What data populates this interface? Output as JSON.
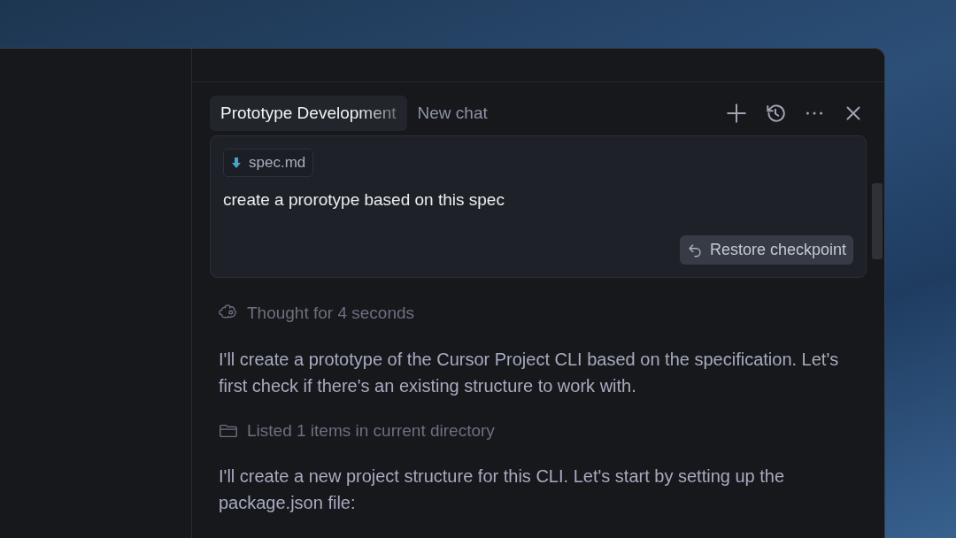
{
  "tabs": [
    {
      "label": "Prototype Development",
      "selected": true
    },
    {
      "label": "New chat",
      "selected": false
    }
  ],
  "message": {
    "attachment": "spec.md",
    "text": "create a prorotype based on this spec",
    "restore_button": "Restore checkpoint"
  },
  "response": [
    {
      "kind": "thought",
      "text": "Thought for 4 seconds"
    },
    {
      "kind": "paragraph",
      "text": "I'll create a prototype of the Cursor Project CLI based on the specification. Let's first check if there's an existing structure to work with."
    },
    {
      "kind": "listing",
      "text": "Listed 1 items in current directory"
    },
    {
      "kind": "paragraph",
      "text": "I'll create a new project structure for this CLI. Let's start by setting up the package.json file:"
    }
  ]
}
